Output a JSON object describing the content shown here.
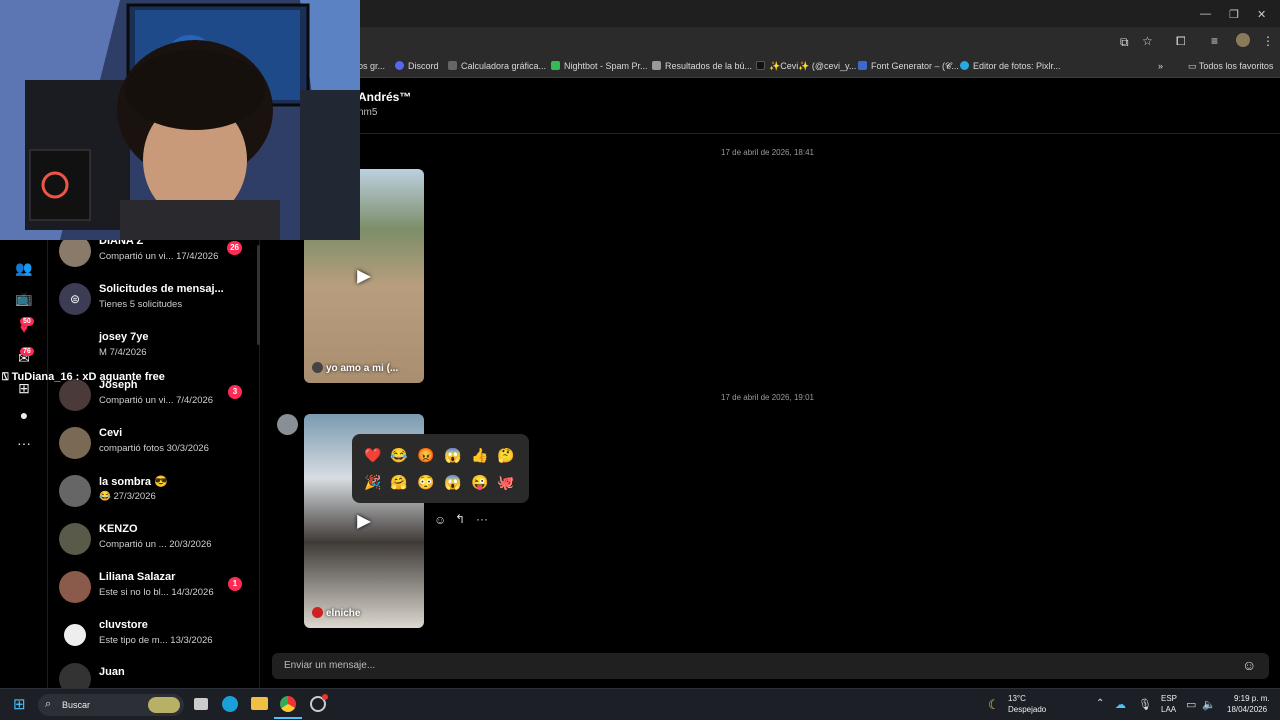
{
  "browser": {
    "bookmarks": [
      {
        "label": "os gr...",
        "color": "#777"
      },
      {
        "label": "Discord",
        "color": "#5865f2"
      },
      {
        "label": "Calculadora gráfica...",
        "color": "#666"
      },
      {
        "label": "Nightbot - Spam Pr...",
        "color": "#3b5"
      },
      {
        "label": "Resultados de la bú...",
        "color": "#999"
      },
      {
        "label": "✨Cevi✨ (@cevi_y...",
        "color": "#222"
      },
      {
        "label": "Font Generator – (𝓒...",
        "color": "#3a6ad0"
      },
      {
        "label": "Editor de fotos: Pixlr...",
        "color": "#2aa8e0"
      }
    ],
    "all_bookmarks": "Todos los favoritos"
  },
  "rail": {
    "badges": [
      "50",
      "76"
    ]
  },
  "conversations": [
    {
      "name": "DIANA Z",
      "preview": "Compartió un vi...",
      "date": "17/4/2026",
      "badge": "26",
      "avatar_color": "#8a7a6a"
    },
    {
      "name": "Solicitudes de mensaj...",
      "preview": "Tienes 5 solicitudes",
      "date": "",
      "badge": "",
      "avatar_color": "#3c3c55"
    },
    {
      "name": "josey 7ye",
      "preview": "M",
      "date": "7/4/2026",
      "badge": "",
      "avatar_color": "#000"
    },
    {
      "name": "Joseph",
      "preview": "Compartió un vi...",
      "date": "7/4/2026",
      "badge": "3",
      "avatar_color": "#4a3a3a"
    },
    {
      "name": "Cevi",
      "preview": "compartió fotos",
      "date": "30/3/2026",
      "badge": "",
      "avatar_color": "#7a6a55"
    },
    {
      "name": "la sombra 😎",
      "preview": "😂",
      "date": "27/3/2026",
      "badge": "",
      "avatar_color": "#666"
    },
    {
      "name": "KENZO",
      "preview": "Compartió un ...",
      "date": "20/3/2026",
      "badge": "",
      "avatar_color": "#5a5a4a"
    },
    {
      "name": "Liliana Salazar",
      "preview": "Este si no lo bl...",
      "date": "14/3/2026",
      "badge": "1",
      "avatar_color": "#8a5a4a"
    },
    {
      "name": "cluvstore",
      "preview": "Este tipo de m...",
      "date": "13/3/2026",
      "badge": "",
      "avatar_color": "#eee"
    },
    {
      "name": "Juan",
      "preview": "",
      "date": "",
      "badge": "",
      "avatar_color": "#333"
    }
  ],
  "chat": {
    "title": "Andrés™",
    "subtitle": "nm5",
    "date1": "17 de abril de 2026, 18:41",
    "date2": "17 de abril de 2026, 19:01",
    "video1_caption": "yo amo a mi (...",
    "video2_caption": "elniche",
    "emojis": [
      "❤️",
      "😂",
      "😡",
      "😱",
      "👍",
      "🤔",
      "🎉",
      "🤗",
      "😳",
      "😱",
      "😜",
      "🐙"
    ],
    "input_placeholder": "Enviar un mensaje..."
  },
  "overlay_chat": "⍂ TuDiana_16 : xD aguante free",
  "taskbar": {
    "search": "Buscar",
    "weather_temp": "13°C",
    "weather_desc": "Despejado",
    "lang1": "ESP",
    "lang2": "LAA",
    "time": "9:19 p. m.",
    "date": "18/04/2026"
  }
}
